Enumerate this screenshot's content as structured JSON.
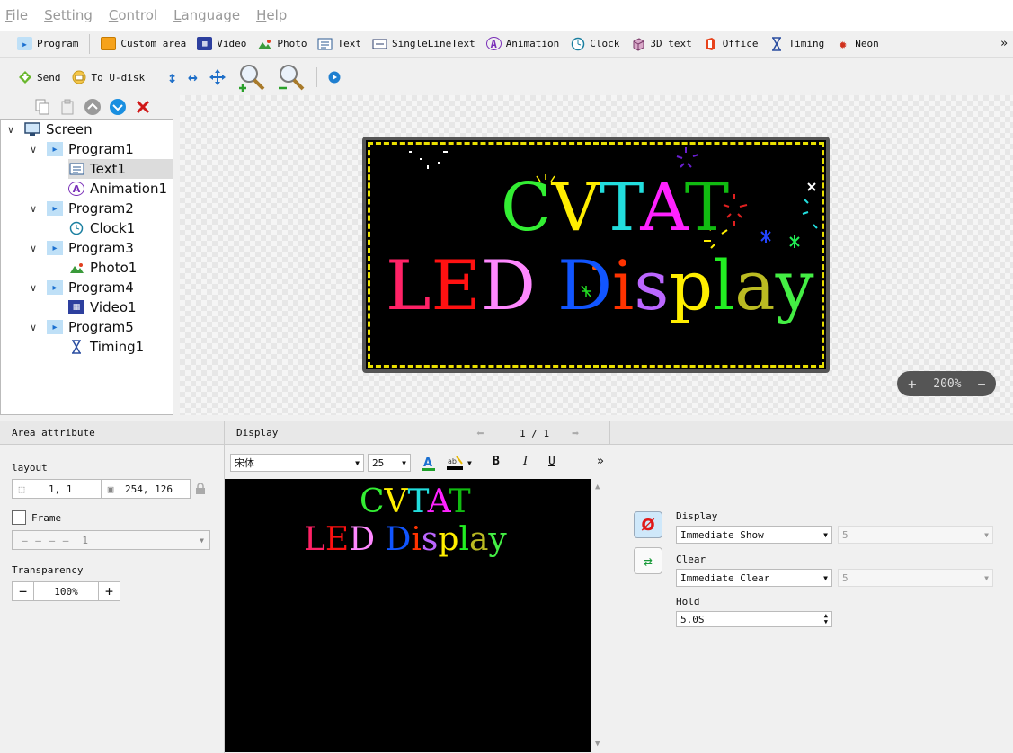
{
  "menu": [
    "File",
    "Setting",
    "Control",
    "Language",
    "Help"
  ],
  "toolbar1": [
    {
      "label": "Program",
      "icon": "program-icon"
    },
    {
      "label": "Custom area",
      "icon": "custom-area-icon"
    },
    {
      "label": "Video",
      "icon": "video-icon"
    },
    {
      "label": "Photo",
      "icon": "photo-icon"
    },
    {
      "label": "Text",
      "icon": "text-icon"
    },
    {
      "label": "SingleLineText",
      "icon": "single-line-text-icon"
    },
    {
      "label": "Animation",
      "icon": "animation-icon"
    },
    {
      "label": "Clock",
      "icon": "clock-icon"
    },
    {
      "label": "3D text",
      "icon": "3d-text-icon"
    },
    {
      "label": "Office",
      "icon": "office-icon"
    },
    {
      "label": "Timing",
      "icon": "timing-icon"
    },
    {
      "label": "Neon",
      "icon": "neon-icon"
    }
  ],
  "toolbar1_more": "»",
  "toolbar2": {
    "send": "Send",
    "udisk": "To U-disk"
  },
  "tree": {
    "root": "Screen",
    "nodes": [
      {
        "label": "Program1",
        "level": 1
      },
      {
        "label": "Text1",
        "level": 2
      },
      {
        "label": "Animation1",
        "level": 2
      },
      {
        "label": "Program2",
        "level": 1
      },
      {
        "label": "Clock1",
        "level": 2
      },
      {
        "label": "Program3",
        "level": 1
      },
      {
        "label": "Photo1",
        "level": 2
      },
      {
        "label": "Program4",
        "level": 1
      },
      {
        "label": "Video1",
        "level": 2
      },
      {
        "label": "Program5",
        "level": 1
      },
      {
        "label": "Timing1",
        "level": 2
      }
    ]
  },
  "led": {
    "line1": [
      "C",
      "V",
      "T",
      "A",
      "T"
    ],
    "line1_colors": [
      "#33ee33",
      "#ffee00",
      "#22dddd",
      "#ff22ff",
      "#11bb11"
    ],
    "line2": [
      "L",
      "E",
      "D",
      " ",
      "D",
      "i",
      "s",
      "p",
      "l",
      "a",
      "y"
    ],
    "line2_colors": [
      "#ff2266",
      "#ff1111",
      "#ff88ff",
      "#000000",
      "#1155ff",
      "#ff3300",
      "#bb66ff",
      "#ffee00",
      "#22ee22",
      "#bbbb22",
      "#44ee44"
    ]
  },
  "zoom": {
    "minus": "+",
    "value": "200%",
    "plus": "—"
  },
  "area_attribute": {
    "title": "Area attribute",
    "layout_label": "layout",
    "position": "1, 1",
    "size": "254, 126",
    "frame_label": "Frame",
    "frame_value": "1",
    "transparency_label": "Transparency",
    "transparency_value": "100%"
  },
  "display_panel": {
    "title": "Display",
    "page": "1 / 1",
    "font": "宋体",
    "font_size": "25",
    "bold": "B",
    "italic": "I",
    "underline": "U",
    "more": "»",
    "preview_line1": [
      "C",
      "V",
      "T",
      "A",
      "T"
    ],
    "preview_line2": [
      "L",
      "E",
      "D",
      " ",
      "D",
      "i",
      "s",
      "p",
      "l",
      "a",
      "y"
    ]
  },
  "effects": {
    "display_label": "Display",
    "display_value": "Immediate Show",
    "display_speed": "5",
    "clear_label": "Clear",
    "clear_value": "Immediate Clear",
    "clear_speed": "5",
    "hold_label": "Hold",
    "hold_value": "5.0S"
  }
}
